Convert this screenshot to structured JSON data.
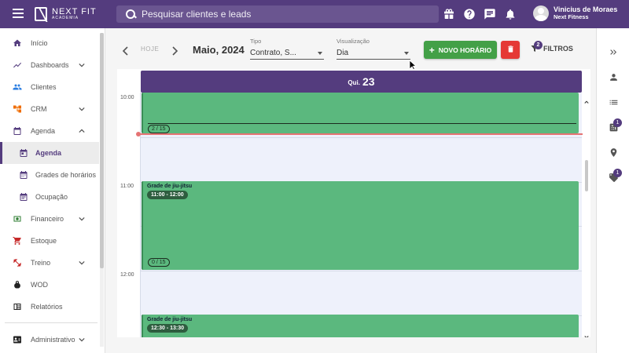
{
  "header": {
    "logo_line1": "NEXT FIT",
    "logo_line2": "ACADEMIA",
    "search_placeholder": "Pesquisar clientes e leads",
    "user_name": "Vinicius de Moraes",
    "user_gym": "Next Fitness"
  },
  "sidebar": {
    "items": [
      {
        "label": "Início",
        "icon": "home-icon"
      },
      {
        "label": "Dashboards",
        "icon": "chart-icon"
      },
      {
        "label": "Clientes",
        "icon": "people-icon"
      },
      {
        "label": "CRM",
        "icon": "crm-icon"
      },
      {
        "label": "Agenda",
        "icon": "calendar-icon"
      },
      {
        "label": "Agenda",
        "icon": "calendar-icon"
      },
      {
        "label": "Grades de horários",
        "icon": "calendar-grid-icon"
      },
      {
        "label": "Ocupação",
        "icon": "calendar-icon"
      },
      {
        "label": "Financeiro",
        "icon": "money-icon"
      },
      {
        "label": "Estoque",
        "icon": "cart-icon"
      },
      {
        "label": "Treino",
        "icon": "dumbbell-icon"
      },
      {
        "label": "WOD",
        "icon": "kettlebell-icon"
      },
      {
        "label": "Relatórios",
        "icon": "report-icon"
      },
      {
        "label": "Administrativo",
        "icon": "admin-icon"
      }
    ]
  },
  "toolbar": {
    "today_label": "HOJE",
    "month_label": "Maio, 2024",
    "tipo_label": "Tipo",
    "tipo_value": "Contrato, S...",
    "view_label": "Visualização",
    "view_value": "Dia",
    "new_button": "NOVO HORÁRIO",
    "filters_label": "FILTROS",
    "filters_count": "2"
  },
  "calendar": {
    "day_of_week": "Qui.",
    "day_number": "23",
    "times": [
      "10:00",
      "11:00",
      "12:00"
    ],
    "events": [
      {
        "title": "",
        "time": "",
        "count": "2 / 15"
      },
      {
        "title": "Grade de jiu-jitsu",
        "time": "11:00 - 12:00",
        "count": "0 / 15"
      },
      {
        "title": "Grade de jiu-jitsu",
        "time": "12:30 - 13:30",
        "count": ""
      }
    ]
  },
  "rail": {
    "badge_1": "1",
    "badge_2": "1"
  },
  "colors": {
    "brand": "#543c7e",
    "event_green": "#5bb87e",
    "new_button": "#43a047",
    "delete_button": "#e53935"
  }
}
